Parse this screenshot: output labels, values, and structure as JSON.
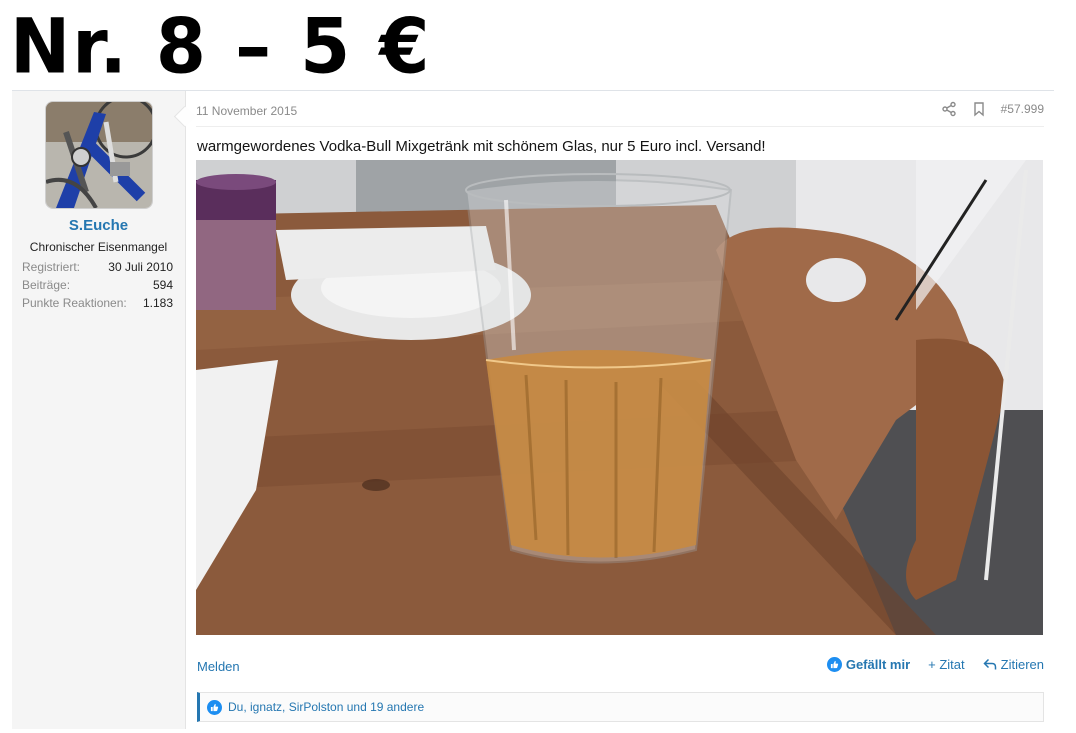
{
  "headline": "Nr. 8 – 5 €",
  "user": {
    "name": "S.Euche",
    "title": "Chronischer Eisenmangel",
    "stats": [
      {
        "label": "Registriert:",
        "value": "30 Juli 2010"
      },
      {
        "label": "Beiträge:",
        "value": "594"
      },
      {
        "label": "Punkte Reaktionen:",
        "value": "1.183"
      }
    ]
  },
  "post": {
    "date": "11 November 2015",
    "number": "#57.999",
    "text": "warmgewordenes Vodka-Bull Mixgetränk mit schönem Glas, nur 5 Euro incl. Versand!",
    "icons": {
      "share": "share-icon",
      "bookmark": "bookmark-icon"
    }
  },
  "footer": {
    "report": "Melden",
    "like": "Gefällt mir",
    "quote": "+ Zitat",
    "reply": "Zitieren"
  },
  "likes": {
    "text": "Du, ignatz, SirPolston und 19 andere"
  },
  "colors": {
    "link": "#2577b1",
    "like_icon": "#1d8ef1",
    "sidebar_bg": "#f5f5f5"
  }
}
